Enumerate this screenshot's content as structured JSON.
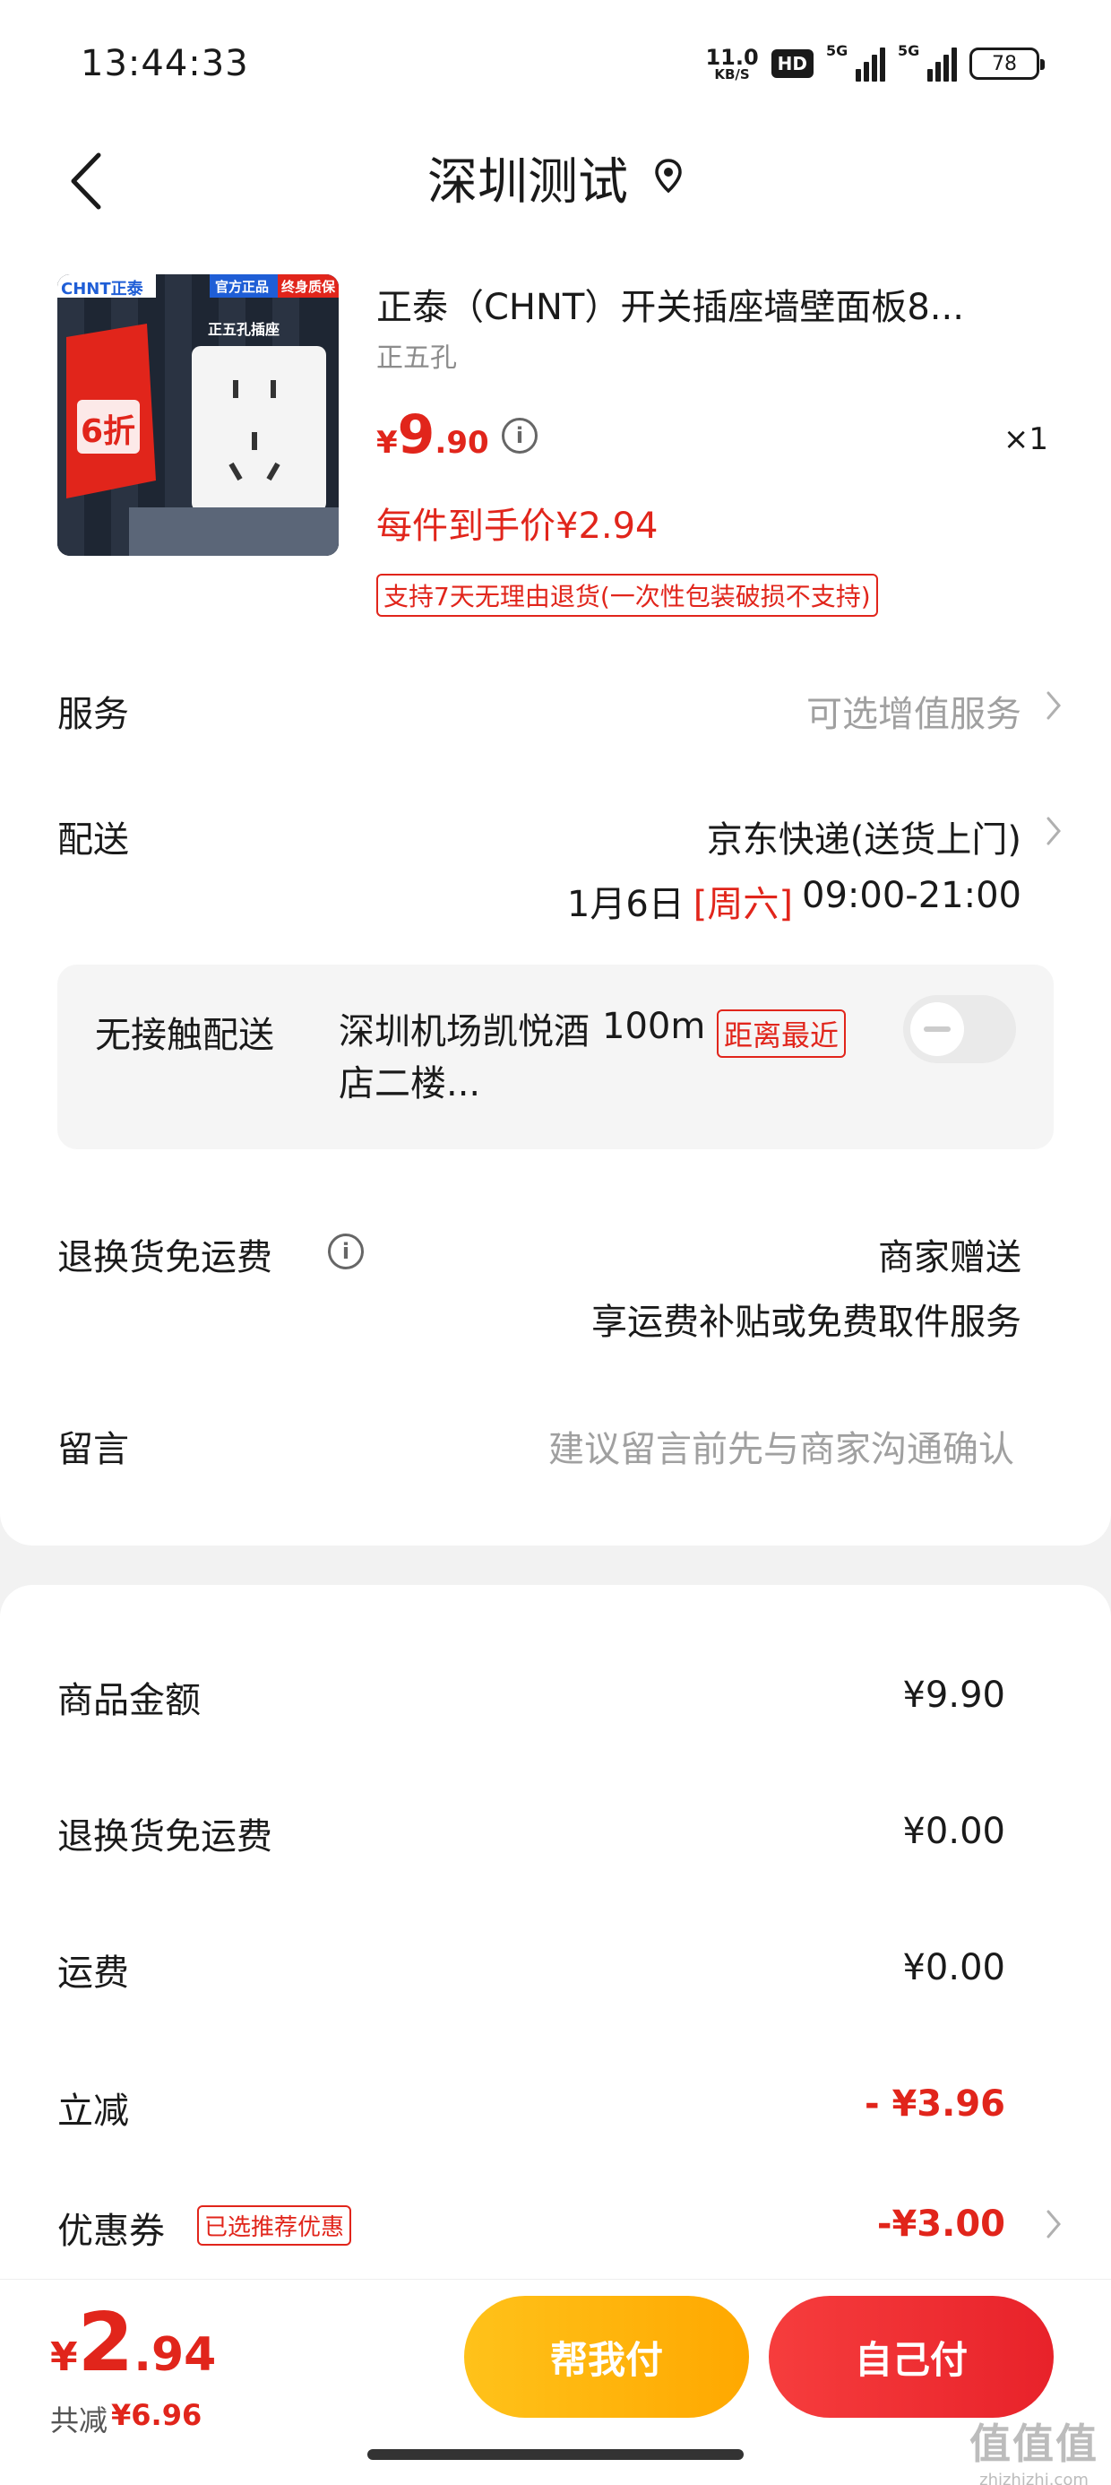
{
  "status_bar": {
    "time": "13:44:33",
    "net_speed": "11.0",
    "net_unit": "KB/S",
    "hd_label": "HD",
    "sig1_label": "5G",
    "sig2_label": "5G",
    "battery": "78"
  },
  "header": {
    "title": "深圳测试",
    "back_icon": "chevron-left-icon",
    "location_icon": "location-pin-icon"
  },
  "product": {
    "image_brand": "CHNT正泰",
    "image_badge1": "官方正品",
    "image_badge2": "终身质保",
    "image_caption": "正五孔插座",
    "image_promo": "6折",
    "title": "正泰（CHNT）开关插座墙壁面板8...",
    "sku": "正五孔",
    "price_currency": "¥",
    "price_int": "9",
    "price_dec": ".90",
    "qty": "×1",
    "per_unit": "每件到手价¥2.94",
    "return_policy": "支持7天无理由退货(一次性包装破损不支持)"
  },
  "service": {
    "label": "服务",
    "value": "可选增值服务"
  },
  "delivery": {
    "label": "配送",
    "method": "京东快递(送货上门)",
    "date": "1月6日",
    "weekday": "[周六]",
    "time": "09:00-21:00"
  },
  "contactless": {
    "label": "无接触配送",
    "address": "深圳机场凯悦酒店二楼...",
    "distance": "100m",
    "tag": "距离最近",
    "enabled": false
  },
  "return_shipping": {
    "label": "退换货免运费",
    "value": "商家赠送",
    "desc": "享运费补贴或免费取件服务"
  },
  "message": {
    "label": "留言",
    "placeholder": "建议留言前先与商家沟通确认"
  },
  "summary": {
    "goods_label": "商品金额",
    "goods_value": "¥9.90",
    "return_label": "退换货免运费",
    "return_value": "¥0.00",
    "shipping_label": "运费",
    "shipping_value": "¥0.00",
    "discount_label": "立减",
    "discount_value": "- ¥3.96",
    "coupon_label": "优惠券",
    "coupon_tag": "已选推荐优惠",
    "coupon_value": "-¥3.00"
  },
  "footer": {
    "total_currency": "¥",
    "total_int": "2",
    "total_dec": ".94",
    "saved_label": "共减",
    "saved_value": "¥6.96",
    "help_pay": "帮我付",
    "self_pay": "自己付"
  },
  "watermark": {
    "main": "值值值",
    "sub": "zhizhizhi.com"
  },
  "colors": {
    "accent": "#e1251b",
    "help_btn": "#ffb400",
    "pay_btn": "#ef2f34"
  }
}
